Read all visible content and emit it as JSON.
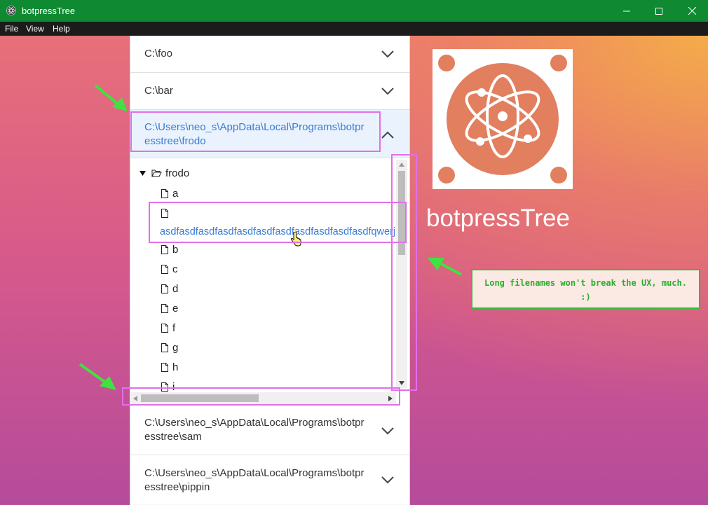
{
  "window": {
    "title": "botpressTree"
  },
  "menu": [
    "File",
    "View",
    "Help"
  ],
  "accordion": {
    "foo": "C:\\foo",
    "bar": "C:\\bar",
    "frodo": {
      "line1": "C:\\Users\\neo_s\\AppData\\Local\\Programs\\botpr",
      "line2": "esstree\\frodo"
    },
    "sam": {
      "line1": "C:\\Users\\neo_s\\AppData\\Local\\Programs\\botpr",
      "line2": "esstree\\sam"
    },
    "pippin": {
      "line1": "C:\\Users\\neo_s\\AppData\\Local\\Programs\\botpr",
      "line2": "esstree\\pippin"
    }
  },
  "tree": {
    "root": "frodo",
    "files": [
      "a",
      "asdfasdfasdfasdfasdfasdfasdfasdfasdfasdfasdfqwerj",
      "b",
      "c",
      "d",
      "e",
      "f",
      "g",
      "h",
      "i"
    ]
  },
  "app_title": "botpressTree",
  "note": {
    "line1": "Long filenames won't break the UX, much.",
    "line2": ":)"
  },
  "colors": {
    "titlebar": "#0f8a33",
    "menubar": "#1b1b1b",
    "selected_text": "#3a7bd5",
    "highlight": "#e070e8",
    "arrow": "#3fe23f",
    "logo_circle": "#e27f5f"
  },
  "icons": [
    "app-icon",
    "minimize-icon",
    "maximize-icon",
    "close-icon",
    "chevron-down-icon",
    "chevron-up-icon",
    "caret-down-icon",
    "folder-open-icon",
    "file-icon",
    "mouse-cursor-icon",
    "electron-logo-icon"
  ]
}
